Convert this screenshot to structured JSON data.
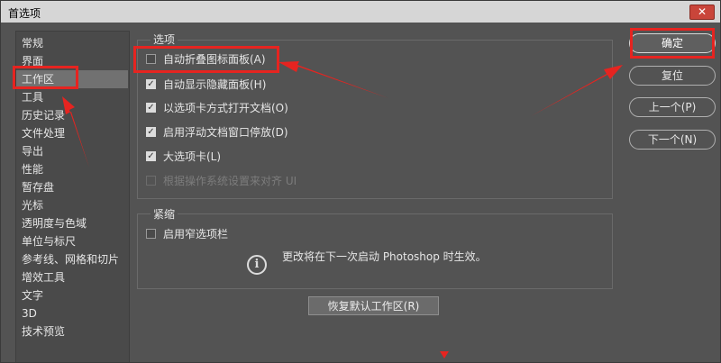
{
  "window": {
    "title": "首选项",
    "close_glyph": "✕"
  },
  "sidebar": {
    "items": [
      {
        "label": "常规"
      },
      {
        "label": "界面"
      },
      {
        "label": "工作区"
      },
      {
        "label": "工具"
      },
      {
        "label": "历史记录"
      },
      {
        "label": "文件处理"
      },
      {
        "label": "导出"
      },
      {
        "label": "性能"
      },
      {
        "label": "暂存盘"
      },
      {
        "label": "光标"
      },
      {
        "label": "透明度与色域"
      },
      {
        "label": "单位与标尺"
      },
      {
        "label": "参考线、网格和切片"
      },
      {
        "label": "增效工具"
      },
      {
        "label": "文字"
      },
      {
        "label": "3D"
      },
      {
        "label": "技术预览"
      }
    ],
    "selected": "工作区"
  },
  "options_group": {
    "title": "选项",
    "items": [
      {
        "label": "自动折叠图标面板(A)",
        "checked": false,
        "disabled": false
      },
      {
        "label": "自动显示隐藏面板(H)",
        "checked": true,
        "disabled": false
      },
      {
        "label": "以选项卡方式打开文档(O)",
        "checked": true,
        "disabled": false
      },
      {
        "label": "启用浮动文档窗口停放(D)",
        "checked": true,
        "disabled": false
      },
      {
        "label": "大选项卡(L)",
        "checked": true,
        "disabled": false
      },
      {
        "label": "根据操作系统设置来对齐 UI",
        "checked": false,
        "disabled": true
      }
    ]
  },
  "condense_group": {
    "title": "紧缩",
    "option": {
      "label": "启用窄选项栏",
      "checked": false
    },
    "info_icon_glyph": "i",
    "info_text": "更改将在下一次启动 Photoshop 时生效。"
  },
  "buttons": {
    "ok": "确定",
    "reset": "复位",
    "prev": "上一个(P)",
    "next": "下一个(N)",
    "restore": "恢复默认工作区(R)"
  },
  "icons": {
    "close": "close-icon",
    "info": "info-icon",
    "check": "check-icon"
  },
  "colors": {
    "dialog_bg": "#535353",
    "titlebar_bg": "#d6d6d6",
    "close_bg": "#c9453a",
    "selection_bg": "#717171",
    "annotation_red": "#e62420"
  }
}
